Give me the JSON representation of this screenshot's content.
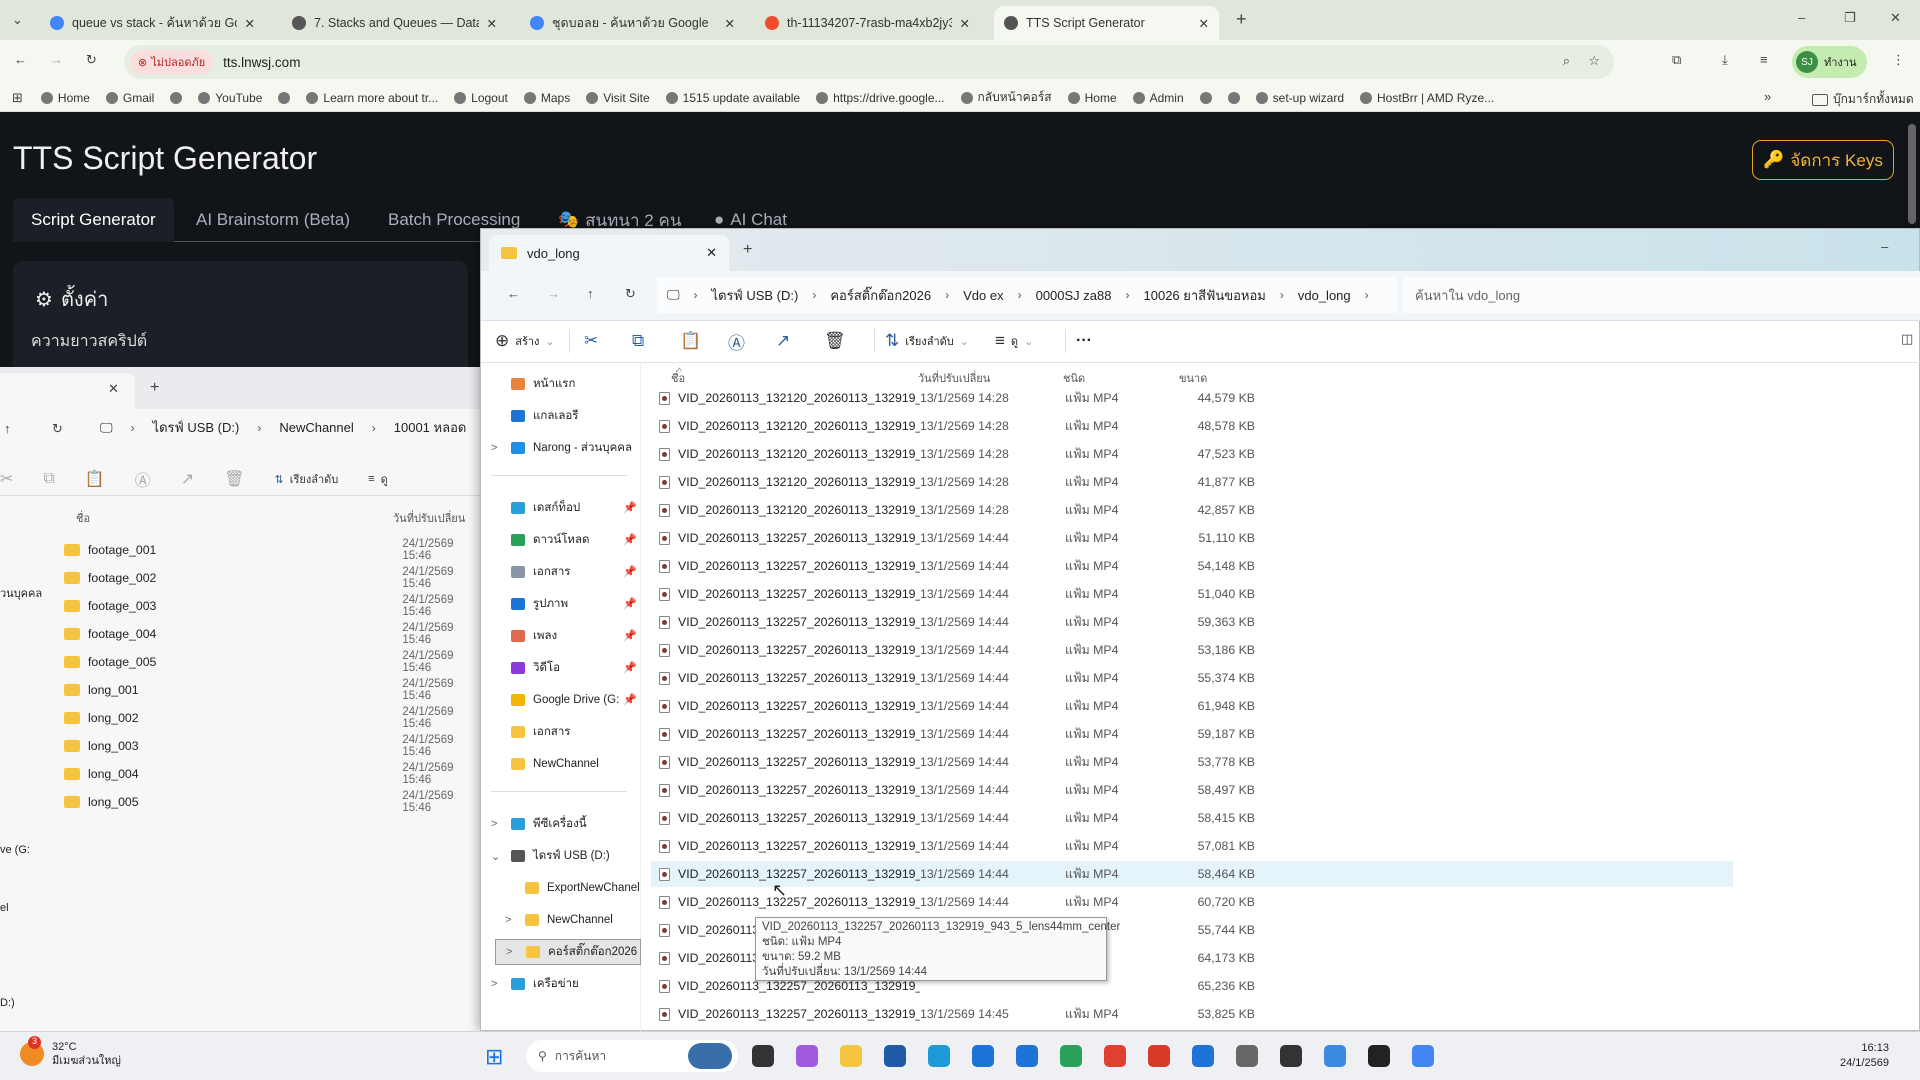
{
  "browser": {
    "tabs": [
      {
        "title": "queue vs stack - ค้นหาด้วย Goog",
        "color": "#4285f4"
      },
      {
        "title": "7. Stacks and Queues — Data S",
        "color": "#555"
      },
      {
        "title": "ชุดบอลย - ค้นหาด้วย Google",
        "color": "#4285f4"
      },
      {
        "title": "th-11134207-7rasb-ma4xb2jy3",
        "color": "#ee4d2d"
      },
      {
        "title": "TTS Script Generator",
        "color": "#555"
      }
    ],
    "security_label": "ไม่ปลอดภัย",
    "url": "tts.lnwsj.com",
    "profile_initials": "SJ",
    "profile_label": "ทำงาน",
    "bookmarks": [
      "Home",
      "Gmail",
      "",
      "YouTube",
      "",
      "Learn more about tr...",
      "Logout",
      "Maps",
      "Visit Site",
      "1515 update available",
      "https://drive.google...",
      "กลับหน้าคอร์ส",
      "Home",
      "Admin",
      "",
      "",
      "set-up wizard",
      "HostBrr | AMD Ryze..."
    ],
    "all_bookmarks": "บุ๊กมาร์กทั้งหมด"
  },
  "app": {
    "title": "TTS Script Generator",
    "keys_button": "จัดการ Keys",
    "tabs": [
      "Script Generator",
      "AI Brainstorm (Beta)",
      "Batch Processing",
      "สนทนา 2 คน",
      "AI Chat"
    ],
    "settings_title": "ตั้งค่า",
    "script_length_label": "ความยาวสคริปต์"
  },
  "explorer_back": {
    "breadcrumb": [
      "ไดรฟ์ USB (D:)",
      "NewChannel",
      "10001 หลอด"
    ],
    "sort_label": "เรียงลำดับ",
    "view_label": "ดู",
    "col_name": "ชื่อ",
    "col_date": "วันที่ปรับเปลี่ยน",
    "nav_partial": [
      "วนบุคคล",
      "ve (G:",
      "el",
      "D:)"
    ],
    "folders": [
      {
        "name": "footage_001",
        "date": "24/1/2569 15:46"
      },
      {
        "name": "footage_002",
        "date": "24/1/2569 15:46"
      },
      {
        "name": "footage_003",
        "date": "24/1/2569 15:46"
      },
      {
        "name": "footage_004",
        "date": "24/1/2569 15:46"
      },
      {
        "name": "footage_005",
        "date": "24/1/2569 15:46"
      },
      {
        "name": "long_001",
        "date": "24/1/2569 15:46"
      },
      {
        "name": "long_002",
        "date": "24/1/2569 15:46"
      },
      {
        "name": "long_003",
        "date": "24/1/2569 15:46"
      },
      {
        "name": "long_004",
        "date": "24/1/2569 15:46"
      },
      {
        "name": "long_005",
        "date": "24/1/2569 15:46"
      }
    ]
  },
  "explorer": {
    "tab_title": "vdo_long",
    "breadcrumb": [
      "ไดรฟ์ USB (D:)",
      "คอร์สติ๊กต๊อก2026",
      "Vdo ex",
      "0000SJ za88",
      "10026 ยาสีฟันขอหอม",
      "vdo_long"
    ],
    "search_placeholder": "ค้นหาใน vdo_long",
    "toolbar": {
      "new": "สร้าง",
      "sort": "เรียงลำดับ",
      "view": "ดู",
      "more": "···"
    },
    "columns": {
      "name": "ชื่อ",
      "date": "วันที่ปรับเปลี่ยน",
      "type": "ชนิด",
      "size": "ขนาด"
    },
    "nav": [
      {
        "label": "หน้าแรก",
        "icon": "home-icon",
        "color": "#e8833a"
      },
      {
        "label": "แกลเลอรี",
        "icon": "gallery-icon",
        "color": "#1e73d6"
      },
      {
        "label": "Narong - ส่วนบุคคล",
        "icon": "onedrive-icon",
        "color": "#1e8ee6",
        "chev": ">"
      },
      {
        "sep": true
      },
      {
        "label": "เดสก์ท็อป",
        "icon": "desktop-icon",
        "color": "#2aa0d8",
        "pin": true
      },
      {
        "label": "ดาวน์โหลด",
        "icon": "download-icon",
        "color": "#2aa05a",
        "pin": true
      },
      {
        "label": "เอกสาร",
        "icon": "documents-icon",
        "color": "#8a96a8",
        "pin": true
      },
      {
        "label": "รูปภาพ",
        "icon": "pictures-icon",
        "color": "#1e73d6",
        "pin": true
      },
      {
        "label": "เพลง",
        "icon": "music-icon",
        "color": "#e06a50",
        "pin": true
      },
      {
        "label": "วิดีโอ",
        "icon": "videos-icon",
        "color": "#8a3ad8",
        "pin": true
      },
      {
        "label": "Google Drive (G:",
        "icon": "google-drive-icon",
        "color": "#f4b400",
        "pin": true
      },
      {
        "label": "เอกสาร",
        "icon": "folder-icon",
        "color": "#f5c542"
      },
      {
        "label": "NewChannel",
        "icon": "folder-icon",
        "color": "#f5c542"
      },
      {
        "sep": true
      },
      {
        "label": "พีซีเครื่องนี้",
        "icon": "pc-icon",
        "color": "#2aa0d8",
        "chev": ">"
      },
      {
        "label": "ไดรฟ์ USB (D:)",
        "icon": "usb-drive-icon",
        "color": "#555",
        "chev": "⌄"
      },
      {
        "label": "ExportNewChanel",
        "icon": "folder-icon",
        "color": "#f5c542",
        "indent": true
      },
      {
        "label": "NewChannel",
        "icon": "folder-icon",
        "color": "#f5c542",
        "indent": true,
        "chev": ">"
      },
      {
        "label": "คอร์สติ๊กต๊อก2026",
        "icon": "folder-icon",
        "color": "#f5c542",
        "indent": true,
        "chev": ">",
        "selected": true
      },
      {
        "label": "เครือข่าย",
        "icon": "network-icon",
        "color": "#2aa0d8",
        "chev": ">"
      }
    ],
    "files": [
      {
        "name": "VID_20260113_132120_20260113_132919_9...",
        "date": "13/1/2569 14:28",
        "type": "แฟ้ม MP4",
        "size": "44,579 KB"
      },
      {
        "name": "VID_20260113_132120_20260113_132919_9...",
        "date": "13/1/2569 14:28",
        "type": "แฟ้ม MP4",
        "size": "48,578 KB"
      },
      {
        "name": "VID_20260113_132120_20260113_132919_9...",
        "date": "13/1/2569 14:28",
        "type": "แฟ้ม MP4",
        "size": "47,523 KB"
      },
      {
        "name": "VID_20260113_132120_20260113_132919_9...",
        "date": "13/1/2569 14:28",
        "type": "แฟ้ม MP4",
        "size": "41,877 KB"
      },
      {
        "name": "VID_20260113_132120_20260113_132919_9...",
        "date": "13/1/2569 14:28",
        "type": "แฟ้ม MP4",
        "size": "42,857 KB"
      },
      {
        "name": "VID_20260113_132257_20260113_132919_9...",
        "date": "13/1/2569 14:44",
        "type": "แฟ้ม MP4",
        "size": "51,110 KB"
      },
      {
        "name": "VID_20260113_132257_20260113_132919_9...",
        "date": "13/1/2569 14:44",
        "type": "แฟ้ม MP4",
        "size": "54,148 KB"
      },
      {
        "name": "VID_20260113_132257_20260113_132919_9...",
        "date": "13/1/2569 14:44",
        "type": "แฟ้ม MP4",
        "size": "51,040 KB"
      },
      {
        "name": "VID_20260113_132257_20260113_132919_9...",
        "date": "13/1/2569 14:44",
        "type": "แฟ้ม MP4",
        "size": "59,363 KB"
      },
      {
        "name": "VID_20260113_132257_20260113_132919_9...",
        "date": "13/1/2569 14:44",
        "type": "แฟ้ม MP4",
        "size": "53,186 KB"
      },
      {
        "name": "VID_20260113_132257_20260113_132919_9...",
        "date": "13/1/2569 14:44",
        "type": "แฟ้ม MP4",
        "size": "55,374 KB"
      },
      {
        "name": "VID_20260113_132257_20260113_132919_9...",
        "date": "13/1/2569 14:44",
        "type": "แฟ้ม MP4",
        "size": "61,948 KB"
      },
      {
        "name": "VID_20260113_132257_20260113_132919_9...",
        "date": "13/1/2569 14:44",
        "type": "แฟ้ม MP4",
        "size": "59,187 KB"
      },
      {
        "name": "VID_20260113_132257_20260113_132919_9...",
        "date": "13/1/2569 14:44",
        "type": "แฟ้ม MP4",
        "size": "53,778 KB"
      },
      {
        "name": "VID_20260113_132257_20260113_132919_9...",
        "date": "13/1/2569 14:44",
        "type": "แฟ้ม MP4",
        "size": "58,497 KB"
      },
      {
        "name": "VID_20260113_132257_20260113_132919_9...",
        "date": "13/1/2569 14:44",
        "type": "แฟ้ม MP4",
        "size": "58,415 KB"
      },
      {
        "name": "VID_20260113_132257_20260113_132919_9...",
        "date": "13/1/2569 14:44",
        "type": "แฟ้ม MP4",
        "size": "57,081 KB"
      },
      {
        "name": "VID_20260113_132257_20260113_132919_9...",
        "date": "13/1/2569 14:44",
        "type": "แฟ้ม MP4",
        "size": "58,464 KB",
        "hover": true
      },
      {
        "name": "VID_20260113_132257_20260113_132919_9...",
        "date": "13/1/2569 14:44",
        "type": "แฟ้ม MP4",
        "size": "60,720 KB"
      },
      {
        "name": "VID_20260113_132257_20260113_132919_9...",
        "date": "",
        "type": "",
        "size": "55,744 KB"
      },
      {
        "name": "VID_20260113_132257_20260113_132919_9...",
        "date": "",
        "type": "",
        "size": "64,173 KB"
      },
      {
        "name": "VID_20260113_132257_20260113_132919_9...",
        "date": "",
        "type": "",
        "size": "65,236 KB"
      },
      {
        "name": "VID_20260113_132257_20260113_132919_9...",
        "date": "13/1/2569 14:45",
        "type": "แฟ้ม MP4",
        "size": "53,825 KB"
      }
    ],
    "tooltip": {
      "name": "VID_20260113_132257_20260113_132919_943_5_lens44mm_center",
      "type": "ชนิด: แฟ้ม MP4",
      "size": "ขนาด: 59.2 MB",
      "date": "วันที่ปรับเปลี่ยน: 13/1/2569 14:44"
    }
  },
  "taskbar": {
    "weather_temp": "32°C",
    "weather_desc": "มีเมฆส่วนใหญ่",
    "weather_badge": "3",
    "search_placeholder": "การค้นหา",
    "time": "16:13",
    "date": "24/1/2569",
    "apps": [
      {
        "name": "terminal-icon",
        "color": "#333"
      },
      {
        "name": "copilot-icon",
        "color": "#a05ae0"
      },
      {
        "name": "file-explorer-icon",
        "color": "#f5c542"
      },
      {
        "name": "store-icon",
        "color": "#1e5aa8"
      },
      {
        "name": "edge-icon",
        "color": "#1e9ad6"
      },
      {
        "name": "outlook-icon",
        "color": "#1e73d6"
      },
      {
        "name": "app-m-icon",
        "color": "#1e73d6"
      },
      {
        "name": "google-drive-icon",
        "color": "#2aa05a"
      },
      {
        "name": "chrome-icon",
        "color": "#e04030"
      },
      {
        "name": "pdf-icon",
        "color": "#d83a2a"
      },
      {
        "name": "app-blue-icon",
        "color": "#1e73d6"
      },
      {
        "name": "settings-icon",
        "color": "#666"
      },
      {
        "name": "pen-icon",
        "color": "#333"
      },
      {
        "name": "app-a-icon",
        "color": "#3a8ae0"
      },
      {
        "name": "app-dark-icon",
        "color": "#222"
      },
      {
        "name": "chrome-profile-icon",
        "color": "#4285f4"
      }
    ]
  }
}
